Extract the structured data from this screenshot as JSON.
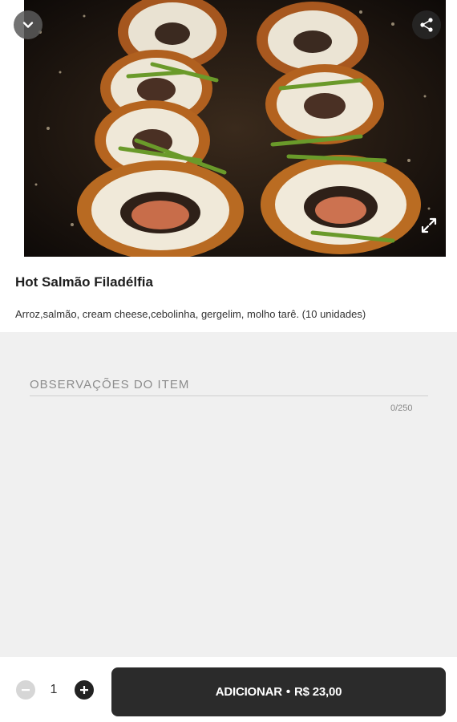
{
  "product": {
    "title": "Hot Salmão Filadélfia",
    "description": "Arroz,salmão, cream cheese,cebolinha, gergelim, molho tarê. (10 unidades)",
    "image_alt": "Hot Salmão Filadélfia"
  },
  "icons": {
    "back": "chevron-down-icon",
    "share": "share-icon",
    "expand": "expand-icon",
    "minus": "minus-icon",
    "plus": "plus-icon"
  },
  "observations": {
    "placeholder": "OBSERVAÇÕES DO ITEM",
    "value": "",
    "counter": "0/250"
  },
  "order": {
    "quantity": "1",
    "add_label": "ADICIONAR",
    "separator": "•",
    "price": "R$ 23,00"
  },
  "colors": {
    "button_bg": "#2b2b2b",
    "obs_bg": "#f0f0f0",
    "title": "#1e1e1e"
  }
}
